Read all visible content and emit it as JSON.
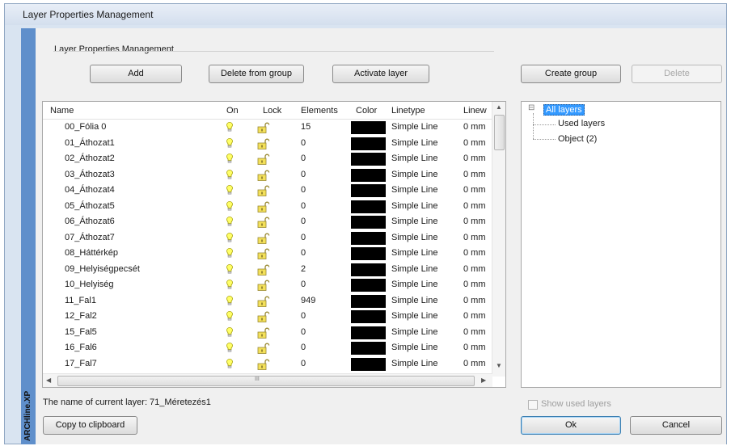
{
  "window": {
    "title": "Layer Properties Management",
    "brand": "ARCHline.XP"
  },
  "group": {
    "title": "Layer Properties Management"
  },
  "toolbar": {
    "add": "Add",
    "delete_from_group": "Delete from group",
    "activate_layer": "Activate layer",
    "create_group": "Create group",
    "delete": "Delete"
  },
  "table": {
    "columns": [
      "Name",
      "On",
      "Lock",
      "Elements",
      "Color",
      "Linetype",
      "Linew"
    ],
    "rows": [
      {
        "name": "00_Fólia 0",
        "elements": "15",
        "linetype": "Simple Line",
        "linew": "0 mm"
      },
      {
        "name": "01_Áthozat1",
        "elements": "0",
        "linetype": "Simple Line",
        "linew": "0 mm"
      },
      {
        "name": "02_Áthozat2",
        "elements": "0",
        "linetype": "Simple Line",
        "linew": "0 mm"
      },
      {
        "name": "03_Áthozat3",
        "elements": "0",
        "linetype": "Simple Line",
        "linew": "0 mm"
      },
      {
        "name": "04_Áthozat4",
        "elements": "0",
        "linetype": "Simple Line",
        "linew": "0 mm"
      },
      {
        "name": "05_Áthozat5",
        "elements": "0",
        "linetype": "Simple Line",
        "linew": "0 mm"
      },
      {
        "name": "06_Áthozat6",
        "elements": "0",
        "linetype": "Simple Line",
        "linew": "0 mm"
      },
      {
        "name": "07_Áthozat7",
        "elements": "0",
        "linetype": "Simple Line",
        "linew": "0 mm"
      },
      {
        "name": "08_Háttérkép",
        "elements": "0",
        "linetype": "Simple Line",
        "linew": "0 mm"
      },
      {
        "name": "09_Helyiségpecsét",
        "elements": "2",
        "linetype": "Simple Line",
        "linew": "0 mm"
      },
      {
        "name": "10_Helyiség",
        "elements": "0",
        "linetype": "Simple Line",
        "linew": "0 mm"
      },
      {
        "name": "11_Fal1",
        "elements": "949",
        "linetype": "Simple Line",
        "linew": "0 mm"
      },
      {
        "name": "12_Fal2",
        "elements": "0",
        "linetype": "Simple Line",
        "linew": "0 mm"
      },
      {
        "name": "15_Fal5",
        "elements": "0",
        "linetype": "Simple Line",
        "linew": "0 mm"
      },
      {
        "name": "16_Fal6",
        "elements": "0",
        "linetype": "Simple Line",
        "linew": "0 mm"
      },
      {
        "name": "17_Fal7",
        "elements": "0",
        "linetype": "Simple Line",
        "linew": "0 mm"
      }
    ],
    "color_swatch": "#000000",
    "scroll_mark": "III"
  },
  "tree": {
    "root": "All layers",
    "children": [
      "Used layers",
      "Object (2)"
    ],
    "expander": "⊟"
  },
  "footer": {
    "current_layer": "The name of current layer: 71_Méretezés1",
    "copy_clipboard": "Copy to clipboard",
    "show_used_layers": "Show used layers",
    "ok": "Ok",
    "cancel": "Cancel"
  }
}
